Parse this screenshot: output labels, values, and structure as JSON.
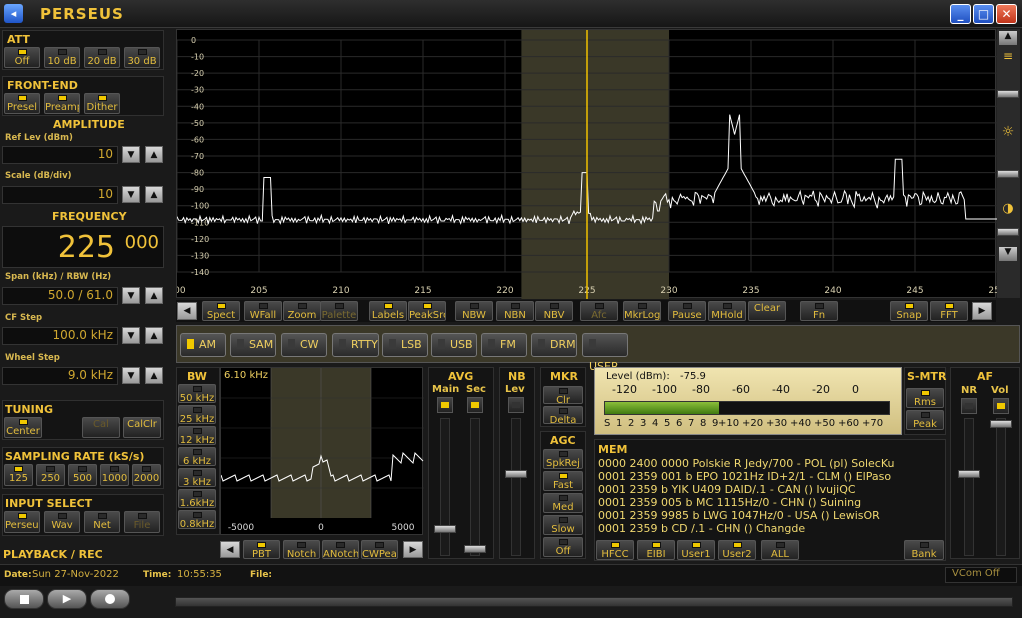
{
  "app": {
    "title": "PERSEUS"
  },
  "att": {
    "label": "ATT",
    "buttons": [
      "Off",
      "10 dB",
      "20 dB",
      "30 dB"
    ]
  },
  "frontend": {
    "label": "FRONT-END",
    "buttons": [
      "Presel",
      "Preamp",
      "Dither"
    ]
  },
  "amplitude": {
    "label": "AMPLITUDE",
    "ref_label": "Ref Lev (dBm)",
    "ref_value": "10",
    "scale_label": "Scale (dB/div)",
    "scale_value": "10"
  },
  "frequency": {
    "label": "FREQUENCY",
    "main": "225",
    "frac": "000",
    "span_label": "Span (kHz) / RBW (Hz)",
    "span_value": "50.0 / 61.0",
    "cf_label": "CF Step",
    "cf_value": "100.0 kHz",
    "wheel_label": "Wheel Step",
    "wheel_value": "9.0 kHz"
  },
  "tuning": {
    "label": "TUNING",
    "buttons": [
      "Center",
      "Cal",
      "CalClr"
    ]
  },
  "sampling": {
    "label": "SAMPLING RATE (kS/s)",
    "buttons": [
      "125",
      "250",
      "500",
      "1000",
      "2000"
    ]
  },
  "input": {
    "label": "INPUT SELECT",
    "buttons": [
      "Perseus",
      "Wav",
      "Net",
      "File"
    ]
  },
  "playback": {
    "label": "PLAYBACK / REC"
  },
  "status": {
    "date_label": "Date:",
    "date": "Sun 27-Nov-2022",
    "time_label": "Time:",
    "time": "10:55:35",
    "file_label": "File:",
    "vcom": "VCom Off"
  },
  "spectrum": {
    "ylabels": [
      "0",
      "-10",
      "-20",
      "-30",
      "-40",
      "-50",
      "-60",
      "-70",
      "-80",
      "-90",
      "-100",
      "-110",
      "-120",
      "-130",
      "-140"
    ],
    "xlabels": [
      "200",
      "205",
      "210",
      "215",
      "220",
      "225",
      "230",
      "235",
      "240",
      "245",
      "250"
    ]
  },
  "spec_buttons": [
    "Spect",
    "WFall",
    "Zoom",
    "Palette",
    "Labels",
    "PeakSrc",
    "NBW",
    "NBN",
    "NBV",
    "Afc",
    "MkrLog",
    "Pause",
    "MHold",
    "Clear",
    "Fn",
    "Snap",
    "FFT"
  ],
  "modes": [
    "AM",
    "SAM",
    "CW",
    "RTTY",
    "LSB",
    "USB",
    "FM",
    "DRM",
    "USER"
  ],
  "bw": {
    "label": "BW",
    "buttons": [
      "50 kHz",
      "25 kHz",
      "12 kHz",
      "6 kHz",
      "3 kHz",
      "1.6kHz",
      "0.8kHz"
    ],
    "value": "6.10 kHz",
    "xlabels": [
      "-5000",
      "0",
      "5000"
    ]
  },
  "filter_buttons": [
    "PBT",
    "Notch",
    "ANotch",
    "CWPeak"
  ],
  "avg": {
    "label": "AVG",
    "main": "Main",
    "sec": "Sec"
  },
  "nb": {
    "label": "NB",
    "lev": "Lev"
  },
  "mkr": {
    "label": "MKR",
    "buttons": [
      "Clr",
      "Delta"
    ]
  },
  "agc": {
    "label": "AGC",
    "buttons": [
      "SpkRej",
      "Fast",
      "Med",
      "Slow",
      "Off"
    ]
  },
  "level": {
    "label": "Level (dBm):",
    "value": "-75.9",
    "top_scale": [
      "-120",
      "-100",
      "-80",
      "-60",
      "-40",
      "-20",
      "0"
    ],
    "bottom_scale": [
      "S",
      "1",
      "2",
      "3",
      "4",
      "5",
      "6",
      "7",
      "8",
      "9",
      "+10",
      "+20",
      "+30",
      "+40",
      "+50",
      "+60",
      "+70"
    ],
    "fraction": 0.4
  },
  "smtr": {
    "label": "S-MTR",
    "buttons": [
      "Rms",
      "Peak"
    ]
  },
  "af": {
    "label": "AF",
    "nr": "NR",
    "vol": "Vol"
  },
  "mem": {
    "label": "MEM",
    "rows": [
      "0000 2400 0000 Polskie R Jedy/700  - POL (pl)  SolecKu",
      "0001 2359 001 b EPO 1021Hz ID+2/1  - CLM ()  ElPaso",
      "0001 2359 b YIK U409 DAID/.1  - CAN ()  IvujiQC",
      "0001 2359 005 b MC 1115Hz/0  - CHN ()  Suining",
      "0001 2359 9985 b LWG 1047Hz/0  - USA ()  LewisOR",
      "0001 2359 b CD /.1  - CHN ()  Changde"
    ],
    "buttons": [
      "HFCC",
      "EIBI",
      "User1",
      "User2",
      "ALL",
      "Bank"
    ]
  },
  "colors": {
    "accent": "#f0c23a",
    "trace": "#ffffff",
    "cursor": "#f0c000",
    "passband": "#3a3828"
  }
}
